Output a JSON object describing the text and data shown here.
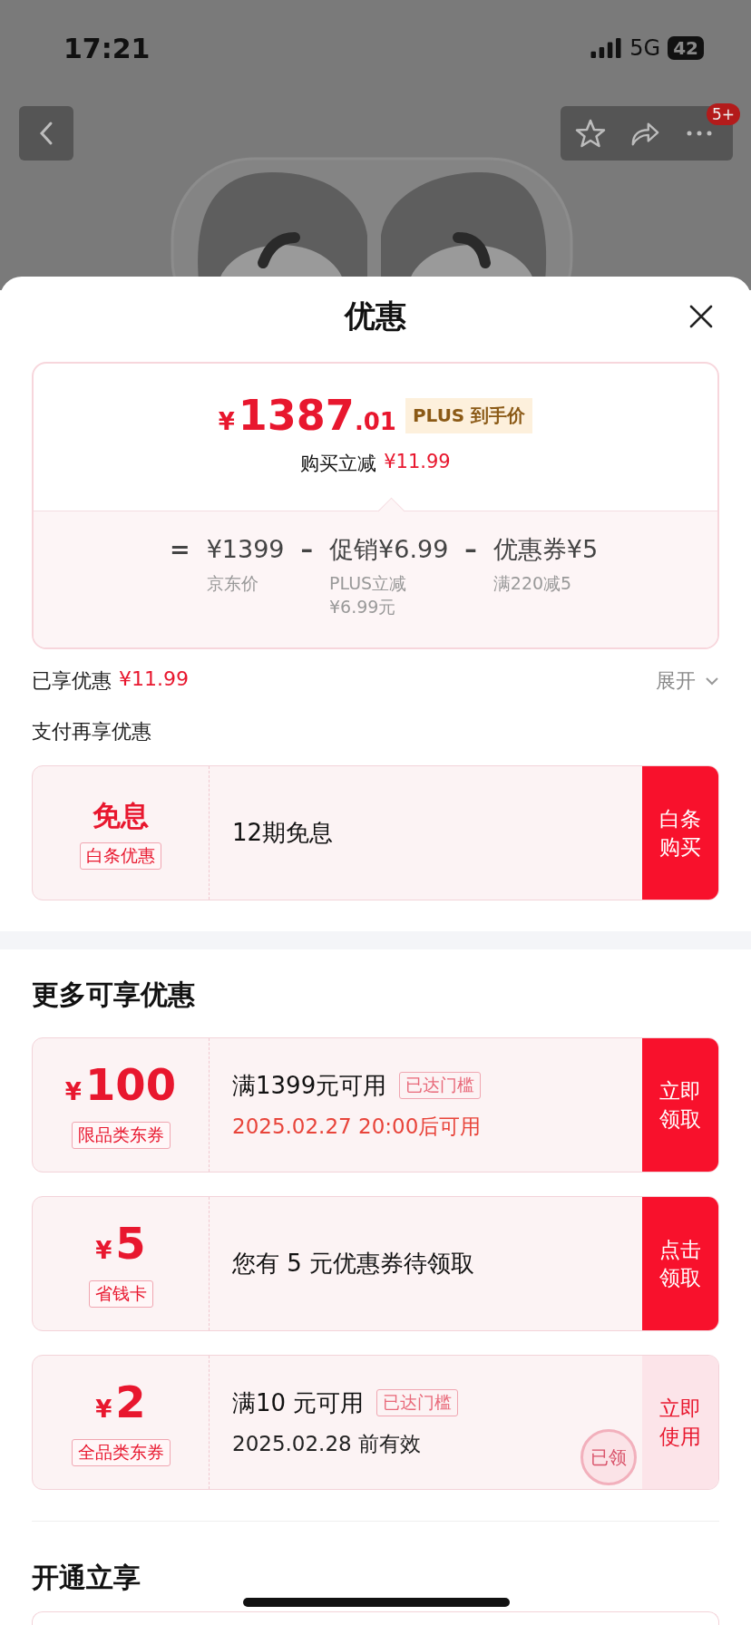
{
  "status_bar": {
    "time": "17:21",
    "network": "5G",
    "battery": "42"
  },
  "nav": {
    "badge": "5+"
  },
  "sheet": {
    "title": "优惠"
  },
  "price_card": {
    "currency": "¥",
    "price_main": "1387",
    "price_decimal": ".01",
    "price_tag": "PLUS 到手价",
    "saving_label": "购买立减",
    "saving_value": "¥11.99",
    "formula": [
      {
        "kind": "op",
        "text": "="
      },
      {
        "kind": "term",
        "text": "¥1399",
        "note": "京东价"
      },
      {
        "kind": "op",
        "text": "–"
      },
      {
        "kind": "term",
        "text": "促销¥6.99",
        "note": "PLUS立减\n¥6.99元"
      },
      {
        "kind": "op",
        "text": "–"
      },
      {
        "kind": "term",
        "text": "优惠券¥5",
        "note": "满220减5"
      }
    ]
  },
  "enjoyed": {
    "label": "已享优惠",
    "value": "¥11.99",
    "expand": "展开"
  },
  "pay_section": {
    "title": "支付再享优惠",
    "offer": {
      "headline": "免息",
      "tag": "白条优惠",
      "text": "12期免息",
      "button": "白条购买"
    }
  },
  "more_section": {
    "title": "更多可享优惠",
    "coupons": [
      {
        "currency": "¥",
        "amount": "100",
        "tag": "限品类东券",
        "main": "满1399元可用",
        "badge": "已达门槛",
        "sub": "2025.02.27 20:00后可用",
        "sub_highlight": true,
        "button": "立即领取",
        "claimed": false
      },
      {
        "currency": "¥",
        "amount": "5",
        "tag": "省钱卡",
        "main": "您有 5 元优惠券待领取",
        "button": "点击领取",
        "claimed": false
      },
      {
        "currency": "¥",
        "amount": "2",
        "tag": "全品类东券",
        "main": "满10 元可用",
        "badge": "已达门槛",
        "sub": "2025.02.28 前有效",
        "sub_highlight": false,
        "button": "立即使用",
        "claimed": true,
        "stamp": "已领"
      }
    ]
  },
  "open_section": {
    "title": "开通立享"
  }
}
